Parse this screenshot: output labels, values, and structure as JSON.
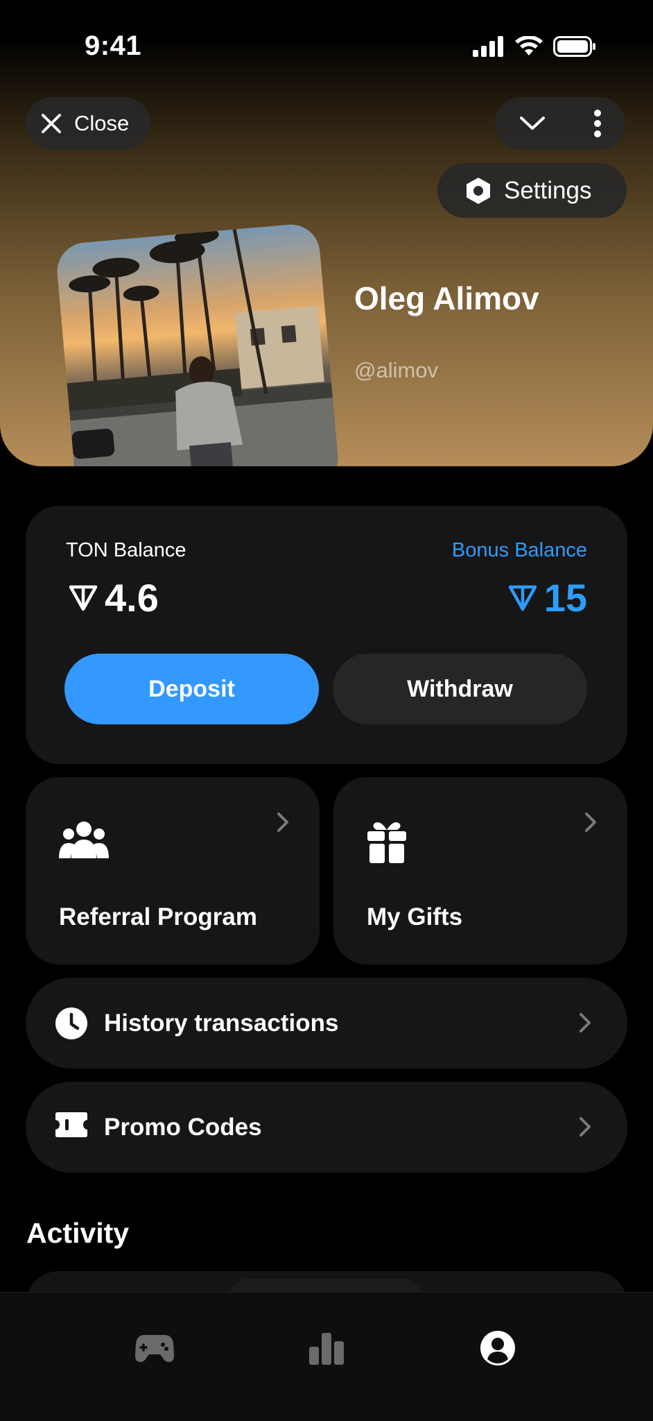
{
  "status_bar": {
    "time": "9:41"
  },
  "header": {
    "close_label": "Close",
    "settings_label": "Settings"
  },
  "profile": {
    "name": "Oleg Alimov",
    "handle": "@alimov"
  },
  "balance": {
    "ton_label": "TON Balance",
    "ton_value": "4.6",
    "bonus_label": "Bonus Balance",
    "bonus_value": "15",
    "deposit_label": "Deposit",
    "withdraw_label": "Withdraw"
  },
  "tiles": [
    {
      "label": "Referral Program",
      "icon": "group-icon"
    },
    {
      "label": "My Gifts",
      "icon": "gift-icon"
    }
  ],
  "rows": [
    {
      "label": "History transactions",
      "icon": "clock-icon"
    },
    {
      "label": "Promo Codes",
      "icon": "ticket-icon"
    }
  ],
  "activity": {
    "title": "Activity"
  },
  "tabbar": [
    {
      "icon": "gamepad-icon",
      "active": false
    },
    {
      "icon": "bar-chart-icon",
      "active": false
    },
    {
      "icon": "profile-icon",
      "active": true
    }
  ],
  "colors": {
    "accent": "#3399ff",
    "bonus_text": "#2d9cff",
    "card_bg": "#161616"
  }
}
